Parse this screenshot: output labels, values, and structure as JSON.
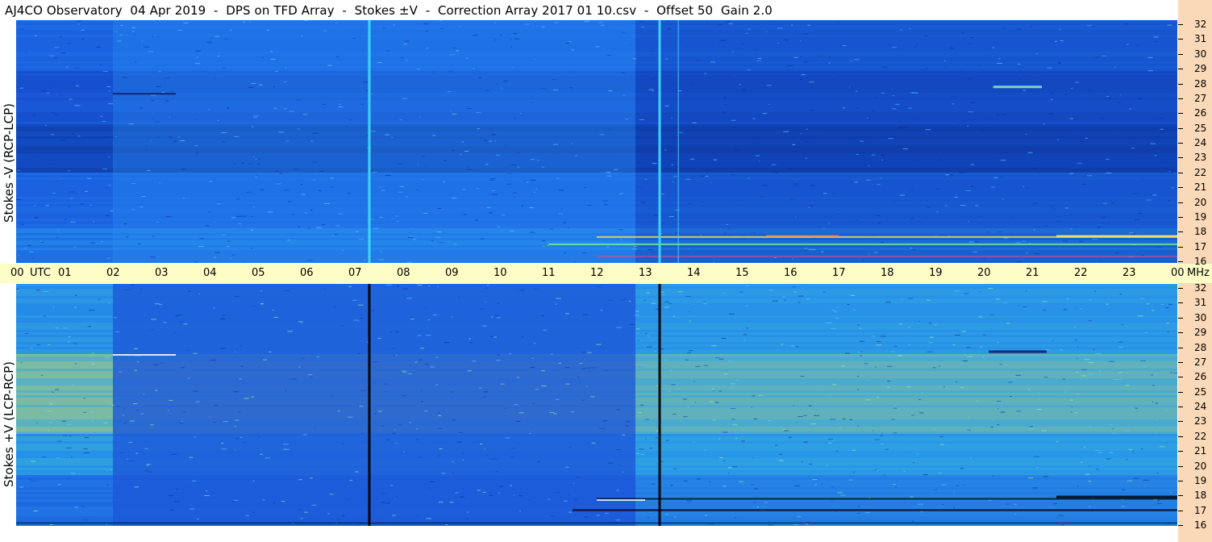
{
  "title": "AJ4CO Observatory  04 Apr 2019  -  DPS on TFD Array  -  Stokes ±V  -  Correction Array 2017 01 10.csv  -  Offset 50  Gain 2.0",
  "colors": {
    "right_strip": "#f9d9b8",
    "time_bar": "#fdfdc6",
    "page": "#ffffff"
  },
  "chart_data": [
    {
      "type": "heatmap",
      "title": "AJ4CO Observatory  04 Apr 2019  -  DPS on TFD Array  -  Stokes ±V  -  Correction Array 2017 01 10.csv  -  Offset 50  Gain 2.0",
      "ylabel": "Stokes -V (RCP-LCP)",
      "x_ticks": [
        "00 UTC",
        "01",
        "02",
        "03",
        "04",
        "05",
        "06",
        "07",
        "08",
        "09",
        "10",
        "11",
        "12",
        "13",
        "14",
        "15",
        "16",
        "17",
        "18",
        "19",
        "20",
        "21",
        "22",
        "23",
        "00"
      ],
      "x_unit": "UTC",
      "y_ticks": [
        "16",
        "17",
        "18",
        "19",
        "20",
        "21",
        "22",
        "23",
        "24",
        "25",
        "26",
        "27",
        "28",
        "29",
        "30",
        "31",
        "32"
      ],
      "y_unit": "MHz",
      "xlim": [
        0,
        24
      ],
      "ylim": [
        16,
        32
      ],
      "vertical_lines_utc": [
        7.3,
        13.3,
        13.7
      ],
      "line_color": "#3fd9ff"
    },
    {
      "type": "heatmap",
      "ylabel": "Stokes +V (LCP-RCP)",
      "x_ticks": [
        "00 UTC",
        "01",
        "02",
        "03",
        "04",
        "05",
        "06",
        "07",
        "08",
        "09",
        "10",
        "11",
        "12",
        "13",
        "14",
        "15",
        "16",
        "17",
        "18",
        "19",
        "20",
        "21",
        "22",
        "23",
        "00"
      ],
      "x_unit": "UTC",
      "y_ticks": [
        "16",
        "17",
        "18",
        "19",
        "20",
        "21",
        "22",
        "23",
        "24",
        "25",
        "26",
        "27",
        "28",
        "29",
        "30",
        "31",
        "32"
      ],
      "y_unit": "MHz",
      "xlim": [
        0,
        24
      ],
      "ylim": [
        16,
        32
      ],
      "vertical_lines_utc": [
        7.3,
        13.3
      ],
      "line_color": "#000000"
    }
  ],
  "time_axis": {
    "labels": [
      "00",
      "UTC",
      "01",
      "02",
      "03",
      "04",
      "05",
      "06",
      "07",
      "08",
      "09",
      "10",
      "11",
      "12",
      "13",
      "14",
      "15",
      "16",
      "17",
      "18",
      "19",
      "20",
      "21",
      "22",
      "23",
      "00"
    ],
    "unit": "MHz"
  }
}
